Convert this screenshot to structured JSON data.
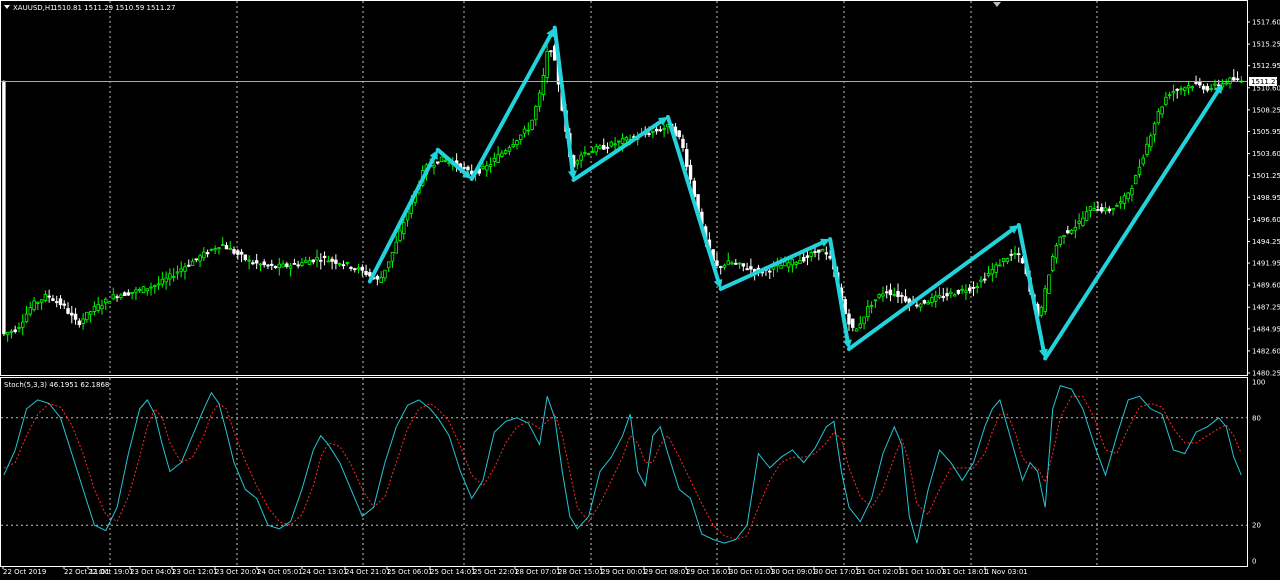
{
  "header": {
    "symbol": "XAUUSD,H1",
    "ohlc": "1510.81 1511.29 1510.59 1511.27"
  },
  "price_panel": {
    "current_price_label": "1511.27",
    "y_ticks": [
      "1517.60",
      "1515.25",
      "1512.95",
      "1510.60",
      "1508.25",
      "1505.95",
      "1503.60",
      "1501.25",
      "1498.95",
      "1496.60",
      "1494.25",
      "1491.95",
      "1489.60",
      "1487.25",
      "1484.95",
      "1482.60",
      "1480.25"
    ]
  },
  "stoch_panel": {
    "label": "Stoch(5,3,3) 46.1951 62.1868",
    "y_ticks": [
      "100",
      "80",
      "20",
      "0"
    ]
  },
  "x_labels": [
    "22 Oct 2019",
    "22 Oct 11:01",
    "22 Oct 19:01",
    "23 Oct 04:01",
    "23 Oct 12:01",
    "23 Oct 20:01",
    "24 Oct 05:01",
    "24 Oct 13:01",
    "24 Oct 21:01",
    "25 Oct 06:01",
    "25 Oct 14:01",
    "25 Oct 22:01",
    "28 Oct 07:01",
    "28 Oct 15:01",
    "29 Oct 00:01",
    "29 Oct 08:01",
    "29 Oct 16:01",
    "30 Oct 01:01",
    "30 Oct 09:01",
    "30 Oct 17:01",
    "31 Oct 02:01",
    "31 Oct 10:01",
    "31 Oct 18:01",
    "1 Nov 03:01"
  ],
  "colors": {
    "background": "#000000",
    "bull_candle": "#00ff00",
    "bear_candle": "#ffffff",
    "arrow": "#22d3dc",
    "grid": "#c0c0c0",
    "stoch_main": "#22c7d6",
    "stoch_signal": "#ff2a2a"
  },
  "chart_data": {
    "type": "line",
    "ylim": [
      1480.25,
      1519.0
    ],
    "stoch_ylim": [
      0,
      100
    ],
    "price_path": [
      [
        0,
        1484.3
      ],
      [
        4,
        1485.0
      ],
      [
        8,
        1487.5
      ],
      [
        12,
        1488.5
      ],
      [
        16,
        1487.5
      ],
      [
        20,
        1485.5
      ],
      [
        24,
        1487.0
      ],
      [
        30,
        1488.5
      ],
      [
        36,
        1489.0
      ],
      [
        42,
        1489.8
      ],
      [
        48,
        1491.5
      ],
      [
        54,
        1493.0
      ],
      [
        58,
        1494.0
      ],
      [
        62,
        1493.0
      ],
      [
        66,
        1492.0
      ],
      [
        72,
        1491.5
      ],
      [
        78,
        1491.8
      ],
      [
        84,
        1492.5
      ],
      [
        90,
        1492.0
      ],
      [
        96,
        1491.0
      ],
      [
        100,
        1490.0
      ],
      [
        104,
        1493.5
      ],
      [
        108,
        1498.0
      ],
      [
        112,
        1502.0
      ],
      [
        116,
        1503.0
      ],
      [
        120,
        1502.5
      ],
      [
        124,
        1501.5
      ],
      [
        128,
        1502.0
      ],
      [
        132,
        1503.5
      ],
      [
        136,
        1505.0
      ],
      [
        140,
        1506.5
      ],
      [
        143,
        1510.5
      ],
      [
        145,
        1515.5
      ],
      [
        147,
        1512.5
      ],
      [
        149,
        1507.0
      ],
      [
        151,
        1502.0
      ],
      [
        153,
        1503.5
      ],
      [
        157,
        1504.0
      ],
      [
        161,
        1504.5
      ],
      [
        165,
        1505.0
      ],
      [
        169,
        1505.5
      ],
      [
        173,
        1506.0
      ],
      [
        177,
        1506.5
      ],
      [
        180,
        1505.0
      ],
      [
        183,
        1500.0
      ],
      [
        186,
        1495.0
      ],
      [
        189,
        1491.5
      ],
      [
        193,
        1492.0
      ],
      [
        197,
        1491.5
      ],
      [
        201,
        1491.0
      ],
      [
        205,
        1491.5
      ],
      [
        209,
        1492.0
      ],
      [
        213,
        1492.5
      ],
      [
        217,
        1493.5
      ],
      [
        220,
        1492.0
      ],
      [
        223,
        1487.0
      ],
      [
        226,
        1484.5
      ],
      [
        230,
        1487.5
      ],
      [
        234,
        1489.0
      ],
      [
        238,
        1488.5
      ],
      [
        242,
        1487.5
      ],
      [
        246,
        1488.0
      ],
      [
        250,
        1488.5
      ],
      [
        254,
        1489.0
      ],
      [
        258,
        1489.5
      ],
      [
        262,
        1491.0
      ],
      [
        266,
        1492.5
      ],
      [
        269,
        1493.0
      ],
      [
        271,
        1491.5
      ],
      [
        273,
        1488.0
      ],
      [
        275,
        1486.0
      ],
      [
        277,
        1490.0
      ],
      [
        279,
        1493.5
      ],
      [
        281,
        1495.0
      ],
      [
        285,
        1496.0
      ],
      [
        289,
        1498.0
      ],
      [
        293,
        1497.5
      ],
      [
        297,
        1498.5
      ],
      [
        300,
        1500.5
      ],
      [
        303,
        1504.0
      ],
      [
        306,
        1507.5
      ],
      [
        309,
        1510.0
      ],
      [
        312,
        1510.5
      ],
      [
        316,
        1511.0
      ],
      [
        320,
        1510.5
      ],
      [
        323,
        1511.0
      ],
      [
        326,
        1511.5
      ],
      [
        328,
        1511.3
      ]
    ],
    "arrows": [
      [
        [
          97,
          1490.0
        ],
        [
          115,
          1504.0
        ]
      ],
      [
        [
          115,
          1504.0
        ],
        [
          124,
          1500.9
        ]
      ],
      [
        [
          124,
          1500.9
        ],
        [
          146,
          1517.0
        ]
      ],
      [
        [
          146,
          1517.0
        ],
        [
          151,
          1500.8
        ]
      ],
      [
        [
          151,
          1500.8
        ],
        [
          176,
          1507.5
        ]
      ],
      [
        [
          176,
          1507.5
        ],
        [
          190,
          1489.2
        ]
      ],
      [
        [
          190,
          1489.2
        ],
        [
          219,
          1494.5
        ]
      ],
      [
        [
          219,
          1494.5
        ],
        [
          224,
          1482.8
        ]
      ],
      [
        [
          224,
          1482.8
        ],
        [
          269,
          1496.0
        ]
      ],
      [
        [
          269,
          1496.0
        ],
        [
          276,
          1481.8
        ]
      ],
      [
        [
          276,
          1481.8
        ],
        [
          323,
          1511.0
        ]
      ]
    ],
    "stoch_main": [
      [
        0,
        48
      ],
      [
        3,
        62
      ],
      [
        6,
        85
      ],
      [
        9,
        90
      ],
      [
        12,
        88
      ],
      [
        15,
        80
      ],
      [
        18,
        60
      ],
      [
        21,
        40
      ],
      [
        24,
        20
      ],
      [
        27,
        17
      ],
      [
        30,
        30
      ],
      [
        33,
        60
      ],
      [
        36,
        85
      ],
      [
        38,
        90
      ],
      [
        40,
        82
      ],
      [
        42,
        65
      ],
      [
        44,
        50
      ],
      [
        47,
        55
      ],
      [
        50,
        70
      ],
      [
        53,
        85
      ],
      [
        55,
        94
      ],
      [
        57,
        88
      ],
      [
        59,
        72
      ],
      [
        61,
        55
      ],
      [
        64,
        40
      ],
      [
        67,
        35
      ],
      [
        70,
        20
      ],
      [
        73,
        18
      ],
      [
        76,
        22
      ],
      [
        79,
        40
      ],
      [
        82,
        62
      ],
      [
        84,
        70
      ],
      [
        86,
        65
      ],
      [
        89,
        55
      ],
      [
        92,
        40
      ],
      [
        95,
        25
      ],
      [
        98,
        30
      ],
      [
        101,
        55
      ],
      [
        104,
        75
      ],
      [
        107,
        87
      ],
      [
        110,
        90
      ],
      [
        113,
        85
      ],
      [
        115,
        80
      ],
      [
        118,
        70
      ],
      [
        121,
        50
      ],
      [
        124,
        35
      ],
      [
        127,
        45
      ],
      [
        130,
        72
      ],
      [
        133,
        78
      ],
      [
        136,
        80
      ],
      [
        139,
        77
      ],
      [
        142,
        65
      ],
      [
        144,
        92
      ],
      [
        146,
        80
      ],
      [
        148,
        50
      ],
      [
        150,
        25
      ],
      [
        152,
        18
      ],
      [
        155,
        25
      ],
      [
        158,
        50
      ],
      [
        161,
        58
      ],
      [
        164,
        70
      ],
      [
        166,
        82
      ],
      [
        168,
        50
      ],
      [
        170,
        42
      ],
      [
        172,
        70
      ],
      [
        174,
        75
      ],
      [
        176,
        60
      ],
      [
        179,
        40
      ],
      [
        182,
        35
      ],
      [
        185,
        15
      ],
      [
        188,
        12
      ],
      [
        191,
        10
      ],
      [
        194,
        12
      ],
      [
        197,
        20
      ],
      [
        200,
        60
      ],
      [
        203,
        52
      ],
      [
        206,
        58
      ],
      [
        209,
        62
      ],
      [
        212,
        55
      ],
      [
        215,
        63
      ],
      [
        218,
        75
      ],
      [
        220,
        78
      ],
      [
        222,
        50
      ],
      [
        224,
        30
      ],
      [
        227,
        22
      ],
      [
        230,
        35
      ],
      [
        233,
        60
      ],
      [
        236,
        75
      ],
      [
        238,
        65
      ],
      [
        240,
        25
      ],
      [
        242,
        10
      ],
      [
        245,
        40
      ],
      [
        248,
        62
      ],
      [
        251,
        55
      ],
      [
        254,
        45
      ],
      [
        257,
        55
      ],
      [
        260,
        75
      ],
      [
        262,
        85
      ],
      [
        264,
        90
      ],
      [
        266,
        75
      ],
      [
        268,
        60
      ],
      [
        270,
        45
      ],
      [
        272,
        55
      ],
      [
        274,
        50
      ],
      [
        276,
        30
      ],
      [
        278,
        85
      ],
      [
        280,
        98
      ],
      [
        283,
        96
      ],
      [
        286,
        85
      ],
      [
        289,
        65
      ],
      [
        292,
        48
      ],
      [
        295,
        70
      ],
      [
        298,
        90
      ],
      [
        301,
        92
      ],
      [
        304,
        85
      ],
      [
        307,
        82
      ],
      [
        310,
        62
      ],
      [
        313,
        60
      ],
      [
        316,
        72
      ],
      [
        319,
        75
      ],
      [
        322,
        80
      ],
      [
        324,
        75
      ],
      [
        326,
        58
      ],
      [
        328,
        48
      ]
    ],
    "stoch_signal": [
      [
        0,
        52
      ],
      [
        3,
        55
      ],
      [
        6,
        70
      ],
      [
        9,
        82
      ],
      [
        12,
        88
      ],
      [
        15,
        86
      ],
      [
        18,
        76
      ],
      [
        21,
        60
      ],
      [
        24,
        40
      ],
      [
        27,
        26
      ],
      [
        30,
        22
      ],
      [
        33,
        36
      ],
      [
        36,
        58
      ],
      [
        38,
        75
      ],
      [
        40,
        85
      ],
      [
        42,
        80
      ],
      [
        44,
        66
      ],
      [
        47,
        55
      ],
      [
        50,
        58
      ],
      [
        53,
        70
      ],
      [
        55,
        82
      ],
      [
        57,
        88
      ],
      [
        59,
        85
      ],
      [
        61,
        72
      ],
      [
        64,
        56
      ],
      [
        67,
        42
      ],
      [
        70,
        30
      ],
      [
        73,
        22
      ],
      [
        76,
        20
      ],
      [
        79,
        26
      ],
      [
        82,
        42
      ],
      [
        84,
        58
      ],
      [
        86,
        66
      ],
      [
        89,
        64
      ],
      [
        92,
        54
      ],
      [
        95,
        40
      ],
      [
        98,
        30
      ],
      [
        101,
        36
      ],
      [
        104,
        55
      ],
      [
        107,
        74
      ],
      [
        110,
        85
      ],
      [
        113,
        88
      ],
      [
        115,
        85
      ],
      [
        118,
        78
      ],
      [
        121,
        64
      ],
      [
        124,
        48
      ],
      [
        127,
        42
      ],
      [
        130,
        52
      ],
      [
        133,
        66
      ],
      [
        136,
        75
      ],
      [
        139,
        78
      ],
      [
        142,
        74
      ],
      [
        144,
        78
      ],
      [
        146,
        82
      ],
      [
        148,
        70
      ],
      [
        150,
        50
      ],
      [
        152,
        30
      ],
      [
        155,
        22
      ],
      [
        158,
        32
      ],
      [
        161,
        45
      ],
      [
        164,
        58
      ],
      [
        166,
        70
      ],
      [
        168,
        66
      ],
      [
        170,
        55
      ],
      [
        172,
        55
      ],
      [
        174,
        65
      ],
      [
        176,
        70
      ],
      [
        179,
        58
      ],
      [
        182,
        45
      ],
      [
        185,
        32
      ],
      [
        188,
        20
      ],
      [
        191,
        14
      ],
      [
        194,
        12
      ],
      [
        197,
        14
      ],
      [
        200,
        30
      ],
      [
        203,
        45
      ],
      [
        206,
        55
      ],
      [
        209,
        58
      ],
      [
        212,
        58
      ],
      [
        215,
        60
      ],
      [
        218,
        66
      ],
      [
        220,
        72
      ],
      [
        222,
        68
      ],
      [
        224,
        52
      ],
      [
        227,
        36
      ],
      [
        230,
        30
      ],
      [
        233,
        40
      ],
      [
        236,
        58
      ],
      [
        238,
        68
      ],
      [
        240,
        55
      ],
      [
        242,
        32
      ],
      [
        245,
        26
      ],
      [
        248,
        40
      ],
      [
        251,
        52
      ],
      [
        254,
        52
      ],
      [
        257,
        52
      ],
      [
        260,
        60
      ],
      [
        262,
        72
      ],
      [
        264,
        82
      ],
      [
        266,
        82
      ],
      [
        268,
        72
      ],
      [
        270,
        58
      ],
      [
        272,
        52
      ],
      [
        274,
        52
      ],
      [
        276,
        44
      ],
      [
        278,
        60
      ],
      [
        280,
        80
      ],
      [
        283,
        92
      ],
      [
        286,
        92
      ],
      [
        289,
        80
      ],
      [
        292,
        62
      ],
      [
        295,
        60
      ],
      [
        298,
        74
      ],
      [
        301,
        86
      ],
      [
        304,
        88
      ],
      [
        307,
        86
      ],
      [
        310,
        74
      ],
      [
        313,
        66
      ],
      [
        316,
        66
      ],
      [
        319,
        70
      ],
      [
        322,
        74
      ],
      [
        324,
        76
      ],
      [
        326,
        70
      ],
      [
        328,
        60
      ]
    ]
  }
}
